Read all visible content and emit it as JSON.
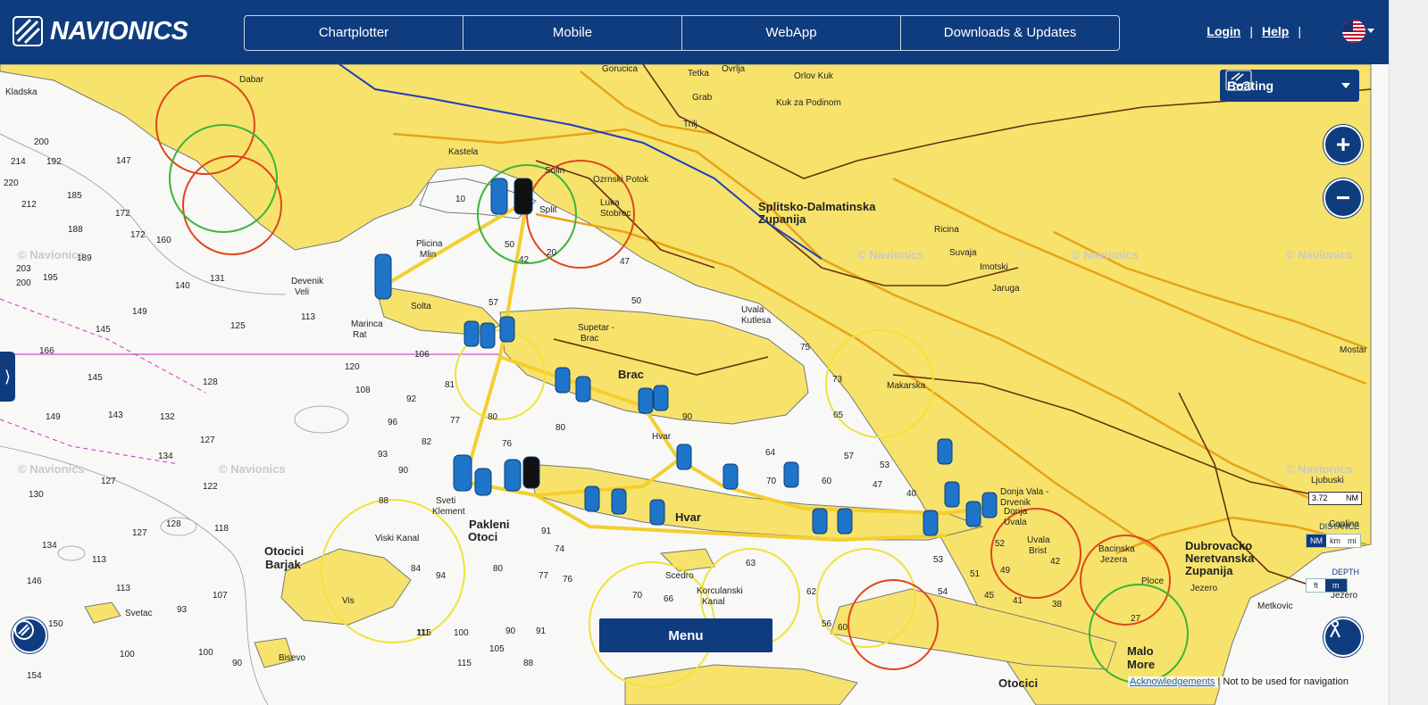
{
  "header": {
    "logo_text": "NAVIONICS",
    "nav_tabs": [
      "Chartplotter",
      "Mobile",
      "WebApp",
      "Downloads & Updates"
    ],
    "login": "Login",
    "help": "Help",
    "separator": "|"
  },
  "map": {
    "mode": "Boating",
    "menu_label": "Menu",
    "watermark": "© Navionics",
    "scale_value": "3.72",
    "scale_unit": "NM",
    "distance_label": "DISTANCE",
    "distance_units": [
      "NM",
      "km",
      "mi"
    ],
    "distance_active": "NM",
    "depth_label": "DEPTH",
    "depth_units": [
      "ft",
      "m"
    ],
    "depth_active": "m",
    "acknowledgements": "Acknowledgements",
    "disclaimer": "Not to be used for navigation",
    "places_big": [
      "Splitsko-Dalmatinska",
      "Zupanija",
      "Brac",
      "Hvar",
      "Pakleni",
      "Otoci",
      "Otocici",
      "Barjak",
      "Dubrovacko",
      "Neretvanska",
      "Zupanija",
      "Malo",
      "More",
      "Otocici"
    ],
    "places_small": [
      "Gorucica",
      "Tetka",
      "Ovrlja",
      "Orlov Kuk",
      "Grab",
      "Kuk za Podinom",
      "Trilj",
      "Kastela",
      "Solin",
      "Ozrnski Potok",
      "Luka",
      "Stobrec",
      "Split",
      "Plicina",
      "Mlin",
      "Devenik",
      "Veli",
      "Marinca",
      "Rat",
      "Solta",
      "Supetar -",
      "Brac",
      "Uvala",
      "Kutlesa",
      "Makarska",
      "Ricina",
      "Suvaja",
      "Imotski",
      "Jaruga",
      "Hvar",
      "Sveti",
      "Klement",
      "Viski Kanal",
      "Vis",
      "Scedro",
      "Korculanski",
      "Kanal",
      "Donja Vala -",
      "Drvenik",
      "Donja",
      "Uvala",
      "Uvala",
      "Brist",
      "Bacinska",
      "Jezera",
      "Ploce",
      "Jezero",
      "Metkovic",
      "Ljubuski",
      "Caplina",
      "Mostar",
      "Dabar",
      "Kladska",
      "Svetac",
      "Bisevo",
      "Jezero"
    ],
    "depths": [
      "214",
      "192",
      "147",
      "200",
      "220",
      "185",
      "212",
      "172",
      "188",
      "172",
      "160",
      "203",
      "189",
      "195",
      "200",
      "140",
      "131",
      "149",
      "145",
      "125",
      "113",
      "166",
      "145",
      "128",
      "120",
      "149",
      "143",
      "132",
      "127",
      "134",
      "130",
      "127",
      "122",
      "134",
      "113",
      "127",
      "128",
      "118",
      "146",
      "113",
      "107",
      "150",
      "100",
      "154",
      "100",
      "93",
      "115",
      "90",
      "96",
      "92",
      "82",
      "93",
      "90",
      "88",
      "81",
      "80",
      "77",
      "76",
      "91",
      "108",
      "106",
      "57",
      "50",
      "50",
      "42",
      "20",
      "10",
      "47",
      "90",
      "80",
      "75",
      "73",
      "65",
      "64",
      "60",
      "57",
      "53",
      "47",
      "40",
      "70",
      "63",
      "62",
      "66",
      "70",
      "74",
      "77",
      "76",
      "84",
      "94",
      "80",
      "91",
      "111",
      "100",
      "90",
      "105",
      "115",
      "88",
      "60",
      "56",
      "54",
      "53",
      "52",
      "51",
      "49",
      "45",
      "41",
      "42",
      "38",
      "27"
    ]
  }
}
